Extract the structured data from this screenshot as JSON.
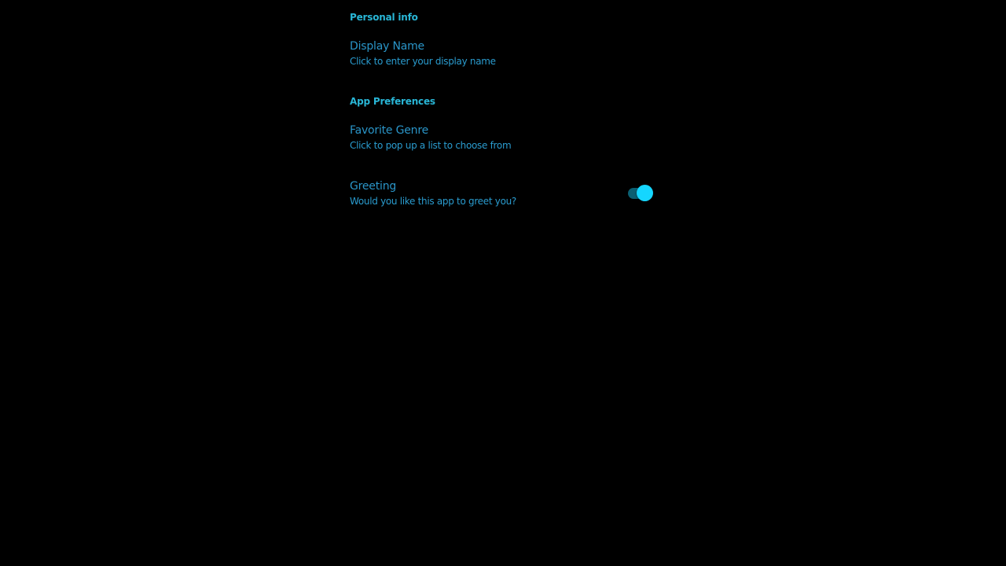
{
  "colors": {
    "background": "#000000",
    "header": "#29b6d6",
    "title": "#2a95c8",
    "summary": "#2a9ccf",
    "switch_thumb": "#15d6ff",
    "switch_track": "#0b5f72"
  },
  "sections": [
    {
      "header": "Personal info",
      "prefs": [
        {
          "title": "Display Name",
          "summary": "Click to enter your display name"
        }
      ]
    },
    {
      "header": "App Preferences",
      "prefs": [
        {
          "title": "Favorite Genre",
          "summary": "Click to pop up a list to choose from"
        },
        {
          "title": "Greeting",
          "summary": "Would you like this app to greet you?",
          "switch_on": true
        }
      ]
    }
  ]
}
